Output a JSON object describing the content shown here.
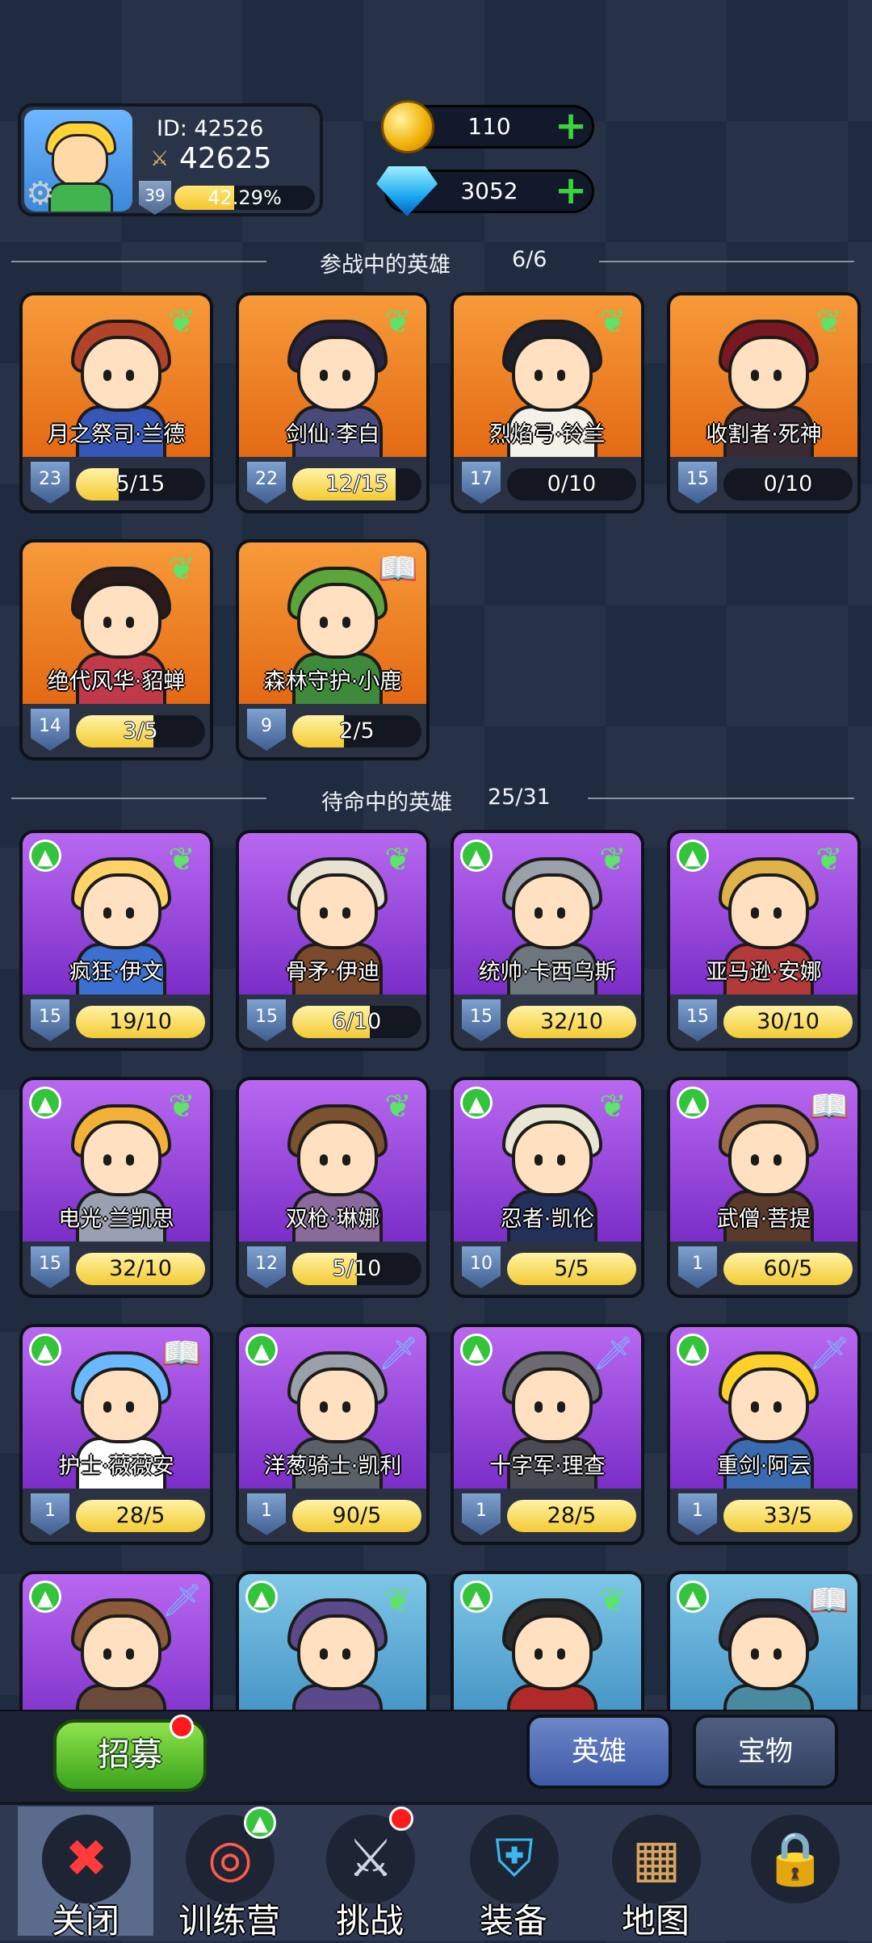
{
  "profile": {
    "id_label": "ID:  42526",
    "power": "42625",
    "level": "39",
    "xp_text": "42.29%",
    "xp_fraction": 0.4229
  },
  "resources": {
    "gold": "110",
    "gems": "3052"
  },
  "active_section": {
    "title": "参战中的英雄",
    "count": "6/6"
  },
  "standby_section": {
    "title": "待命中的英雄",
    "count": "25/31"
  },
  "active_heroes": [
    {
      "name": "月之祭司·兰德",
      "level": "23",
      "progress": "5/15",
      "fill": 0.33,
      "class_icon": "wing",
      "hair": "#b0432a",
      "body": "#3657b8"
    },
    {
      "name": "剑仙·李白",
      "level": "22",
      "progress": "12/15",
      "fill": 0.8,
      "class_icon": "wing",
      "hair": "#2a2440",
      "body": "#4a4a7a"
    },
    {
      "name": "烈焰弓·铃兰",
      "level": "17",
      "progress": "0/10",
      "fill": 0,
      "class_icon": "wing",
      "hair": "#1f1f2a",
      "body": "#f4f0ea"
    },
    {
      "name": "收割者·死神",
      "level": "15",
      "progress": "0/10",
      "fill": 0,
      "class_icon": "wing",
      "hair": "#7a1822",
      "body": "#3a2a33"
    },
    {
      "name": "绝代风华·貂蝉",
      "level": "14",
      "progress": "3/5",
      "fill": 0.6,
      "class_icon": "wing",
      "hair": "#2a1a1a",
      "body": "#c03a4a"
    },
    {
      "name": "森林守护·小鹿",
      "level": "9",
      "progress": "2/5",
      "fill": 0.4,
      "class_icon": "book",
      "hair": "#5aa63a",
      "body": "#3f8a3a"
    }
  ],
  "standby_heroes": [
    {
      "name": "疯狂·伊文",
      "level": "15",
      "progress": "19/10",
      "fill": 1,
      "class_icon": "wing",
      "upgrade": true,
      "hair": "#ffd26a",
      "body": "#3b6fd0",
      "theme": "purple"
    },
    {
      "name": "骨矛·伊迪",
      "level": "15",
      "progress": "6/10",
      "fill": 0.6,
      "class_icon": "wing",
      "upgrade": false,
      "hair": "#e9e2d0",
      "body": "#7a4a2a",
      "theme": "purple"
    },
    {
      "name": "统帅·卡西乌斯",
      "level": "15",
      "progress": "32/10",
      "fill": 1,
      "class_icon": "wing",
      "upgrade": true,
      "hair": "#9aa0a8",
      "body": "#6e7680",
      "theme": "purple"
    },
    {
      "name": "亚马逊·安娜",
      "level": "15",
      "progress": "30/10",
      "fill": 1,
      "class_icon": "wing",
      "upgrade": true,
      "hair": "#e0b24a",
      "body": "#b23a3a",
      "theme": "purple"
    },
    {
      "name": "电光·兰凯思",
      "level": "15",
      "progress": "32/10",
      "fill": 1,
      "class_icon": "wing",
      "upgrade": true,
      "hair": "#f2b23a",
      "body": "#9aa0b0",
      "theme": "purple"
    },
    {
      "name": "双枪·琳娜",
      "level": "12",
      "progress": "5/10",
      "fill": 0.5,
      "class_icon": "wing",
      "upgrade": false,
      "hair": "#7a5230",
      "body": "#8a6a9a",
      "theme": "purple"
    },
    {
      "name": "忍者·凯伦",
      "level": "10",
      "progress": "5/5",
      "fill": 1,
      "class_icon": "wing",
      "upgrade": true,
      "hair": "#e9e6d6",
      "body": "#22305a",
      "theme": "purple"
    },
    {
      "name": "武僧·菩提",
      "level": "1",
      "progress": "60/5",
      "fill": 1,
      "class_icon": "book",
      "upgrade": true,
      "hair": "#9a6a4a",
      "body": "#5a3a2a",
      "theme": "purple"
    },
    {
      "name": "护士·薇薇安",
      "level": "1",
      "progress": "28/5",
      "fill": 1,
      "class_icon": "book",
      "upgrade": true,
      "hair": "#6ab8ff",
      "body": "#ffffff",
      "theme": "purple"
    },
    {
      "name": "洋葱骑士·凯利",
      "level": "1",
      "progress": "90/5",
      "fill": 1,
      "class_icon": "sword",
      "upgrade": true,
      "hair": "#9aa0a8",
      "body": "#5a6068",
      "theme": "purple"
    },
    {
      "name": "十字军·理查",
      "level": "1",
      "progress": "28/5",
      "fill": 1,
      "class_icon": "sword",
      "upgrade": true,
      "hair": "#6a6a70",
      "body": "#4a4a52",
      "theme": "purple"
    },
    {
      "name": "重剑·阿云",
      "level": "1",
      "progress": "33/5",
      "fill": 1,
      "class_icon": "sword",
      "upgrade": true,
      "hair": "#ffcf2a",
      "body": "#3a6ab0",
      "theme": "purple"
    },
    {
      "name": "",
      "level": "",
      "progress": "",
      "fill": 0,
      "class_icon": "sword",
      "upgrade": true,
      "hair": "#8a5a3a",
      "body": "#6a4a3a",
      "theme": "purple"
    },
    {
      "name": "",
      "level": "",
      "progress": "",
      "fill": 0,
      "class_icon": "wing",
      "upgrade": true,
      "hair": "#5a4a8a",
      "body": "#5a4a8a",
      "theme": "teal"
    },
    {
      "name": "",
      "level": "",
      "progress": "",
      "fill": 0,
      "class_icon": "wing",
      "upgrade": true,
      "hair": "#2a2a2a",
      "body": "#b02a2a",
      "theme": "teal"
    },
    {
      "name": "",
      "level": "",
      "progress": "",
      "fill": 0,
      "class_icon": "book",
      "upgrade": true,
      "hair": "#2a2a3a",
      "body": "#4a8aa0",
      "theme": "teal"
    }
  ],
  "buttons": {
    "recruit": "招募",
    "tab_heroes": "英雄",
    "tab_treasure": "宝物"
  },
  "nav": [
    {
      "label": "关闭",
      "icon": "close-icon",
      "glyph": "✖",
      "color": "#ff3b3b"
    },
    {
      "label": "训练营",
      "icon": "target-icon",
      "glyph": "◎",
      "color": "#ff5a4a"
    },
    {
      "label": "挑战",
      "icon": "sword-icon",
      "glyph": "⚔",
      "color": "#cfd6e6"
    },
    {
      "label": "装备",
      "icon": "armor-icon",
      "glyph": "⛨",
      "color": "#3ab6f0"
    },
    {
      "label": "地图",
      "icon": "map-icon",
      "glyph": "▦",
      "color": "#d9a45a"
    },
    {
      "label": "",
      "icon": "lock-icon",
      "glyph": "🔒",
      "color": "#b8bcc6"
    }
  ],
  "icons": {
    "wing": "❦",
    "book": "📖",
    "sword": "🗡"
  }
}
